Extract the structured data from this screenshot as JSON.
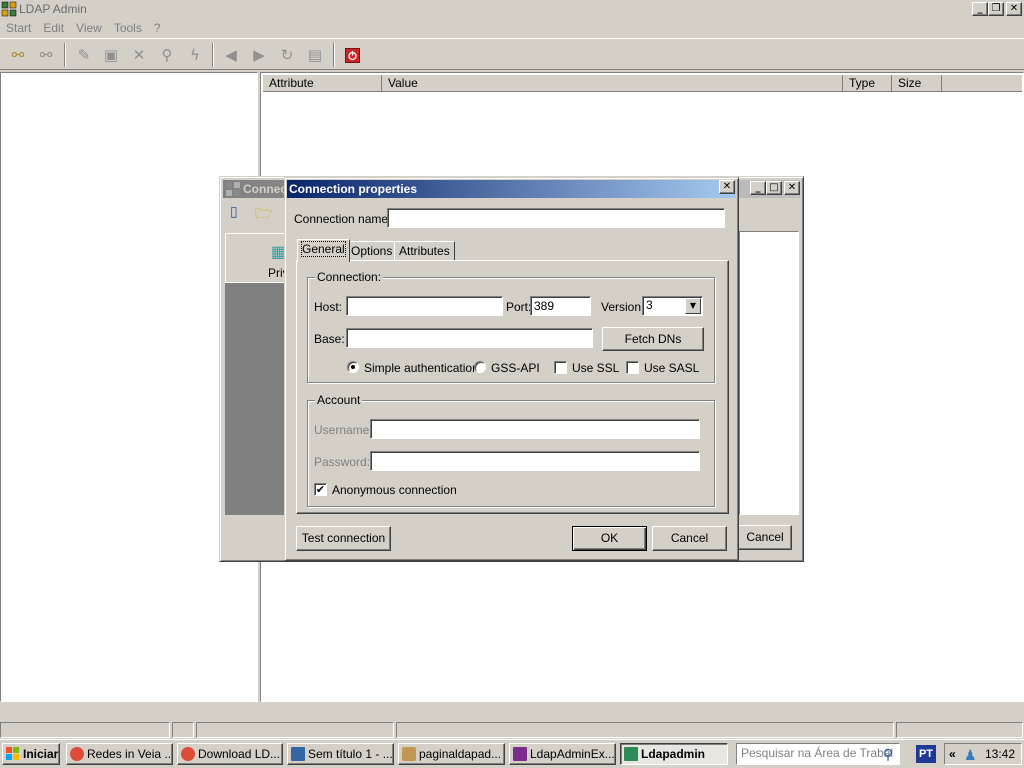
{
  "app": {
    "title": "LDAP Admin"
  },
  "menu": [
    "Start",
    "Edit",
    "View",
    "Tools",
    "?"
  ],
  "toolbar": {
    "icons": [
      "connect-icon",
      "disconnect-icon",
      "edit-entry-icon",
      "save-entry-icon",
      "delete-icon",
      "search-icon",
      "lightning-icon",
      "back-icon",
      "forward-icon",
      "refresh-icon",
      "properties-icon",
      "exit-icon"
    ]
  },
  "attributes": {
    "headers": {
      "attribute": "Attribute",
      "value": "Value",
      "type": "Type",
      "size": "Size"
    }
  },
  "connections_window": {
    "title": "Connec",
    "left_item": "Priv",
    "cancel_label": "Cancel"
  },
  "dialog": {
    "title": "Connection properties",
    "connection_name_label": "Connection name:",
    "connection_name_value": "",
    "tabs": [
      "General",
      "Options",
      "Attributes"
    ],
    "active_tab": "General",
    "connection_group": "Connection:",
    "host_label": "Host:",
    "host_value": "",
    "port_label": "Port:",
    "port_value": "389",
    "version_label": "Version:",
    "version_value": "3",
    "base_label": "Base:",
    "base_value": "",
    "fetch_dns_label": "Fetch DNs",
    "auth_simple": "Simple authentication",
    "auth_gss": "GSS-API",
    "use_ssl": "Use SSL",
    "use_sasl": "Use SASL",
    "account_group": "Account",
    "username_label": "Username:",
    "password_label": "Password:",
    "anonymous_label": "Anonymous connection",
    "anonymous_checked": true,
    "test_connection_label": "Test connection",
    "ok_label": "OK",
    "cancel_label": "Cancel"
  },
  "taskbar": {
    "start_label": "Iniciar",
    "tasks": [
      {
        "label": "Redes in Veia ...",
        "icon": "chrome-icon",
        "color": "#dd4b39"
      },
      {
        "label": "Download LD...",
        "icon": "chrome-icon",
        "color": "#dd4b39"
      },
      {
        "label": "Sem título 1 - ...",
        "icon": "writer-icon",
        "color": "#3465a4"
      },
      {
        "label": "paginaldapad...",
        "icon": "paint-icon",
        "color": "#c09853"
      },
      {
        "label": "LdapAdminEx...",
        "icon": "winrar-icon",
        "color": "#7b2d8b"
      },
      {
        "label": "Ldapadmin",
        "icon": "ldapadmin-icon",
        "color": "#2e8b57"
      }
    ],
    "search_placeholder": "Pesquisar na Área de Trabal",
    "lang": "PT",
    "time": "13:42"
  }
}
